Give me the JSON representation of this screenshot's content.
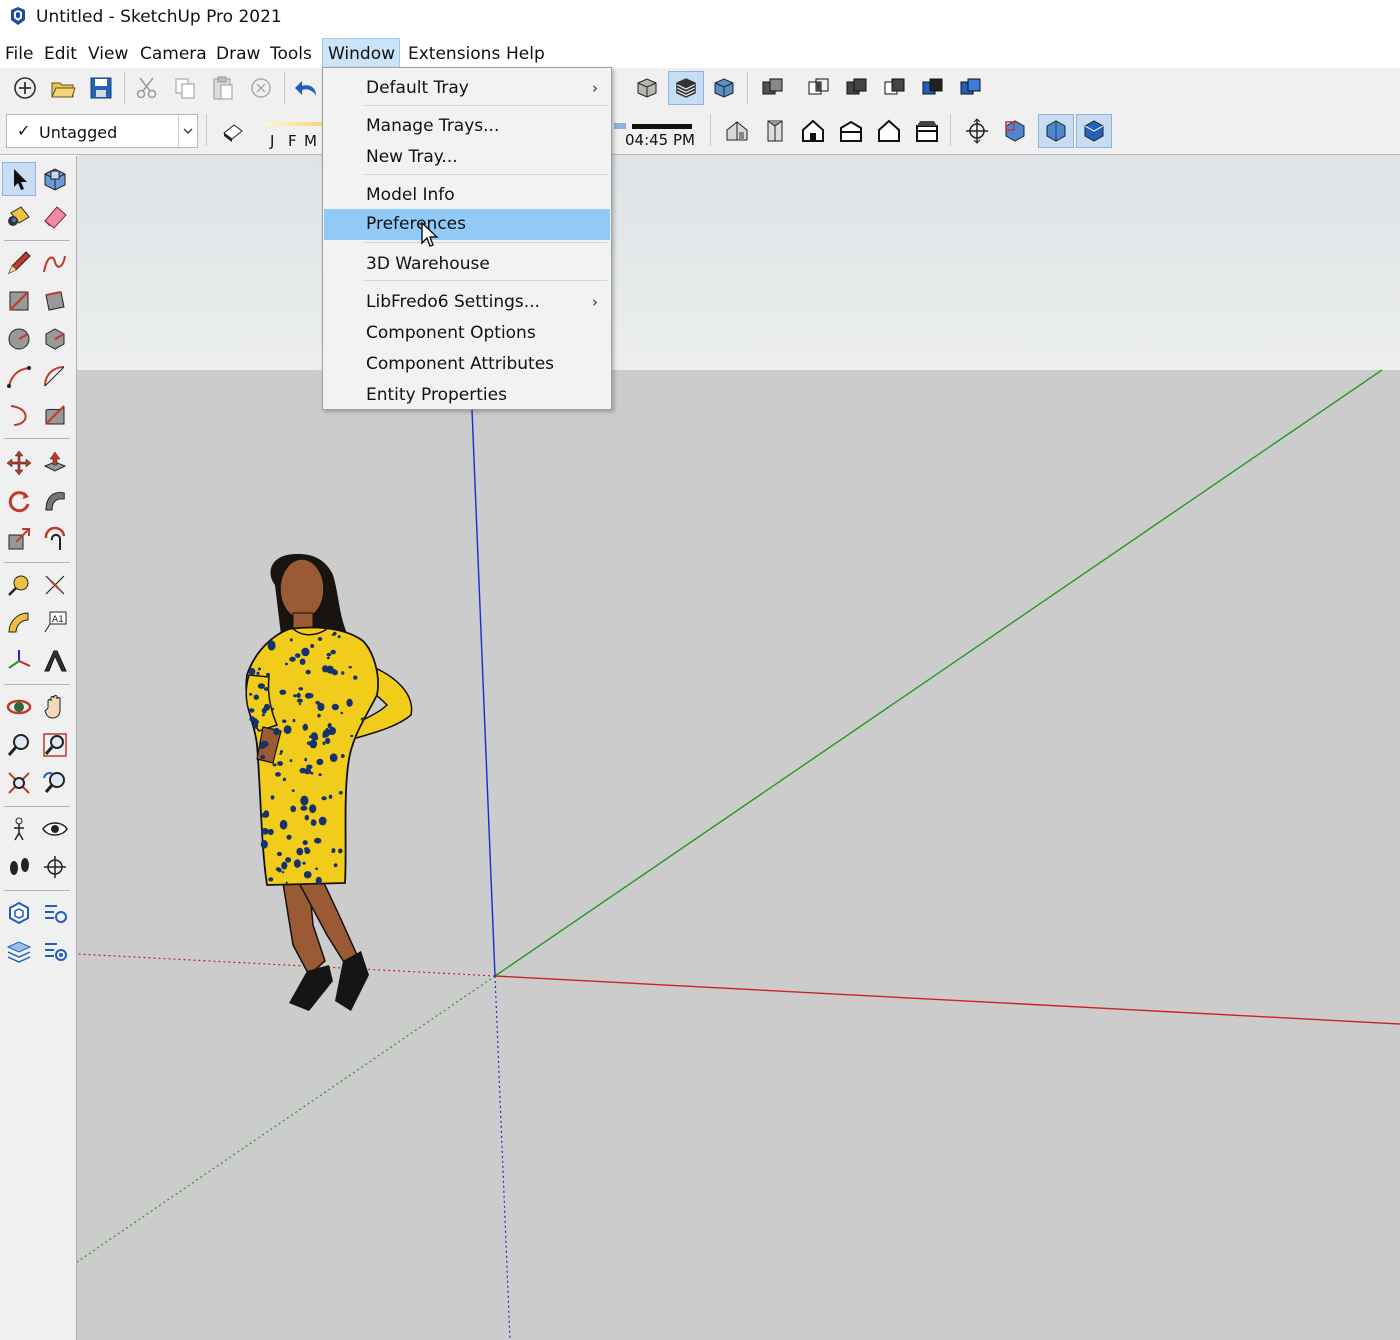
{
  "window": {
    "title": "Untitled - SketchUp Pro 2021"
  },
  "menubar": {
    "items": [
      {
        "label": "File",
        "active": false
      },
      {
        "label": "Edit",
        "active": false
      },
      {
        "label": "View",
        "active": false
      },
      {
        "label": "Camera",
        "active": false
      },
      {
        "label": "Draw",
        "active": false
      },
      {
        "label": "Tools",
        "active": false
      },
      {
        "label": "Window",
        "active": true
      },
      {
        "label": "Extensions",
        "active": false
      },
      {
        "label": "Help",
        "active": false
      }
    ]
  },
  "toolbar": {
    "tag_selector": {
      "check": "✓",
      "value": "Untagged"
    },
    "shadow": {
      "months": [
        "J",
        "F",
        "M"
      ],
      "time": "04:45 PM"
    }
  },
  "window_menu": {
    "items": [
      {
        "label": "Default Tray",
        "submenu": true
      },
      {
        "label": "Manage Trays...",
        "submenu": false
      },
      {
        "label": "New Tray...",
        "submenu": false
      },
      {
        "label": "Model Info",
        "submenu": false
      },
      {
        "label": "Preferences",
        "submenu": false,
        "highlighted": true
      },
      {
        "label": "3D Warehouse",
        "submenu": false
      },
      {
        "label": "LibFredo6 Settings...",
        "submenu": true
      },
      {
        "label": "Component Options",
        "submenu": false
      },
      {
        "label": "Component Attributes",
        "submenu": false
      },
      {
        "label": "Entity Properties",
        "submenu": false
      }
    ],
    "submenu_glyph": "›"
  },
  "colors": {
    "sky": "#e9ecee",
    "ground": "#cccccc",
    "axis_red": "#cc2222",
    "axis_green": "#1f9b1f",
    "axis_blue": "#1a2ccc",
    "menu_highlight": "#91c9f7",
    "dress_yellow": "#f2cc1a",
    "dress_dots": "#16326e",
    "skin": "#9a5a34"
  }
}
